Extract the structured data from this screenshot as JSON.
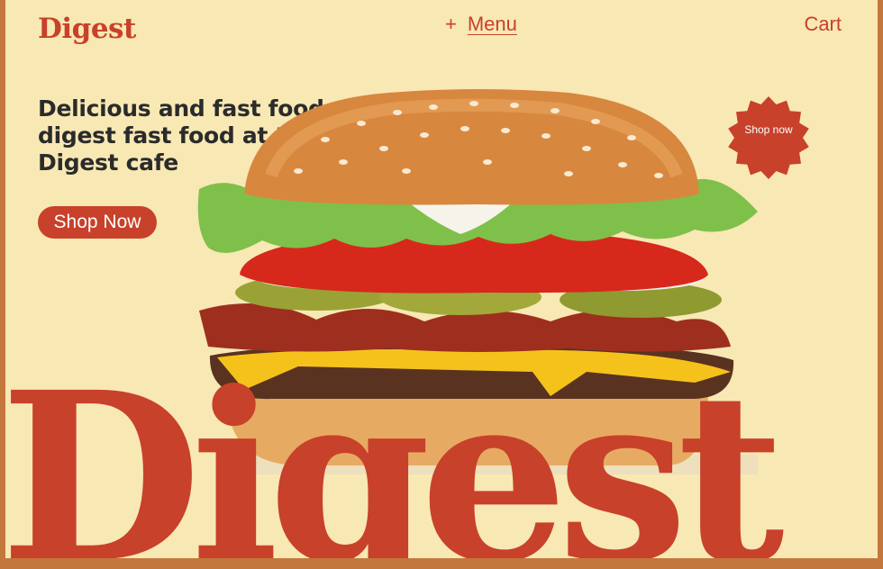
{
  "brand": {
    "logo_text": "Digest",
    "primary_color": "#c8412a",
    "text_color": "#2b2b2b",
    "background_color": "#f8e8b4"
  },
  "nav": {
    "menu_icon": "plus-icon",
    "menu_plus": "+",
    "menu_label": "Menu",
    "cart_label": "Cart"
  },
  "hero": {
    "headline": "Delicious and fast food: digest fast food at the Digest cafe",
    "cta_label": "Shop Now",
    "badge_label": "Shop now",
    "image": "burger-photo",
    "big_word": "Digest"
  }
}
